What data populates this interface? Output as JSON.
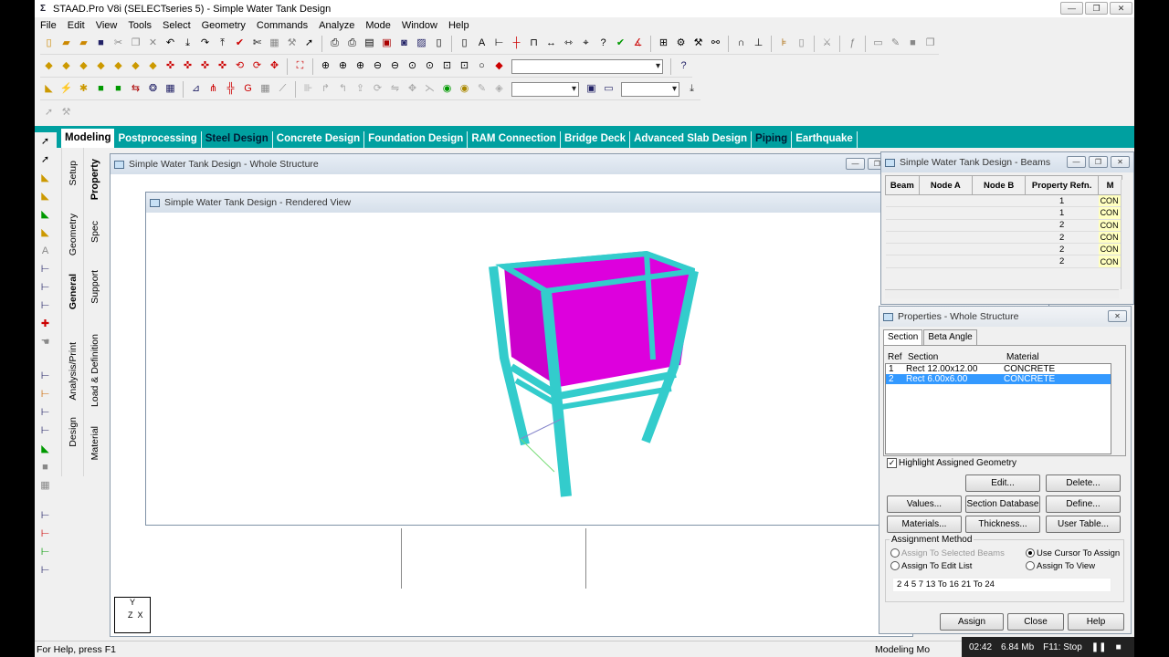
{
  "app": {
    "title": "STAAD.Pro V8i (SELECTseries 5) - Simple Water Tank Design",
    "icon_glyph": "Σ"
  },
  "window_buttons": {
    "minimize": "—",
    "restore": "❐",
    "close": "✕"
  },
  "menu": [
    "File",
    "Edit",
    "View",
    "Tools",
    "Select",
    "Geometry",
    "Commands",
    "Analyze",
    "Mode",
    "Window",
    "Help"
  ],
  "workflow_tabs": [
    {
      "label": "Modeling",
      "active": true
    },
    {
      "label": "Postprocessing"
    },
    {
      "label": "Steel Design",
      "alt": true
    },
    {
      "label": "Concrete Design"
    },
    {
      "label": "Foundation Design"
    },
    {
      "label": "RAM Connection"
    },
    {
      "label": "Bridge Deck"
    },
    {
      "label": "Advanced Slab Design"
    },
    {
      "label": "Piping",
      "alt": true
    },
    {
      "label": "Earthquake"
    }
  ],
  "page_tabs_outer": [
    "Setup",
    "Geometry",
    "General",
    "Analysis/Print",
    "Design"
  ],
  "page_tabs_inner": [
    "Property",
    "Spec",
    "Support",
    "Load & Definition",
    "Material"
  ],
  "whole_structure": {
    "title": "Simple Water Tank Design - Whole Structure",
    "axis_y": "Y",
    "axis_zx": "Z  X"
  },
  "rendered_view": {
    "title": "Simple Water Tank Design - Rendered View",
    "colors": {
      "tank": "#cc00cc",
      "frame": "#33cccc"
    }
  },
  "beams_table": {
    "title": "Simple Water Tank Design - Beams",
    "columns": [
      "Beam",
      "Node A",
      "Node B",
      "Property Refn.",
      "M"
    ],
    "rows": [
      {
        "prop": "1",
        "mat": "CON"
      },
      {
        "prop": "1",
        "mat": "CON"
      },
      {
        "prop": "2",
        "mat": "CON"
      },
      {
        "prop": "2",
        "mat": "CON"
      },
      {
        "prop": "2",
        "mat": "CON"
      },
      {
        "prop": "2",
        "mat": "CON"
      }
    ]
  },
  "properties": {
    "title": "Properties - Whole Structure",
    "tabs": [
      "Section",
      "Beta Angle"
    ],
    "columns": [
      "Ref",
      "Section",
      "Material"
    ],
    "rows": [
      {
        "ref": "1",
        "section": "Rect 12.00x12.00",
        "material": "CONCRETE",
        "selected": false
      },
      {
        "ref": "2",
        "section": "Rect 6.00x6.00",
        "material": "CONCRETE",
        "selected": true
      }
    ],
    "highlight_label": "Highlight Assigned Geometry",
    "highlight_checked": true,
    "buttons": {
      "edit": "Edit...",
      "delete": "Delete...",
      "values": "Values...",
      "section_db": "Section Database",
      "define": "Define...",
      "materials": "Materials...",
      "thickness": "Thickness...",
      "user_table": "User Table..."
    },
    "assignment": {
      "legend": "Assignment Method",
      "to_selected": "Assign To Selected Beams",
      "use_cursor": "Use Cursor To Assign",
      "to_edit": "Assign To Edit List",
      "to_view": "Assign To View",
      "edit_list": "2 4 5 7 13 To 16 21 To 24"
    },
    "bottom": {
      "assign": "Assign",
      "close": "Close",
      "help": "Help"
    }
  },
  "status": {
    "help": "For Help, press F1",
    "mode": "Modeling Mo"
  },
  "tray": {
    "time": "02:42",
    "size": "6.84 Mb",
    "stop": "F11: Stop"
  }
}
